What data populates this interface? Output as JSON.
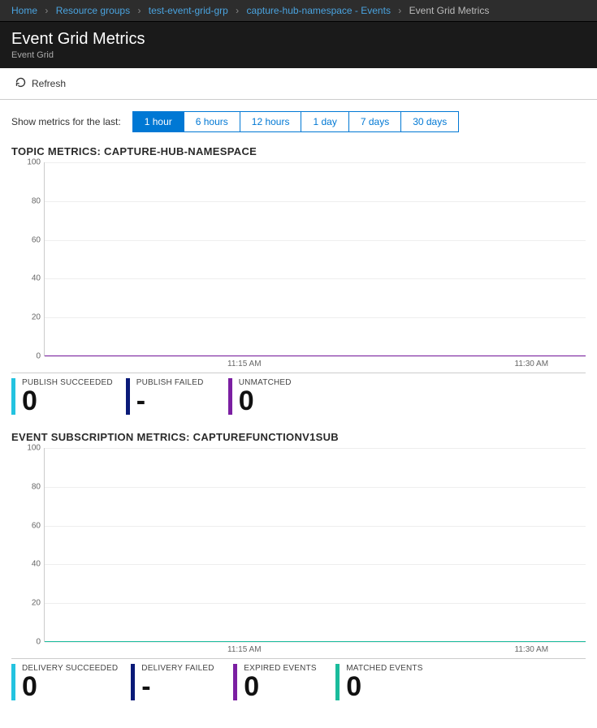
{
  "breadcrumbs": {
    "i0": "Home",
    "i1": "Resource groups",
    "i2": "test-event-grid-grp",
    "i3": "capture-hub-namespace - Events",
    "current": "Event Grid Metrics"
  },
  "header": {
    "title": "Event Grid Metrics",
    "subtitle": "Event Grid"
  },
  "toolbar": {
    "refresh_label": "Refresh"
  },
  "filter": {
    "label": "Show metrics for the last:"
  },
  "time_tabs": {
    "t0": "1 hour",
    "t1": "6 hours",
    "t2": "12 hours",
    "t3": "1 day",
    "t4": "7 days",
    "t5": "30 days",
    "selected_index": 0
  },
  "colors": {
    "cyan": "#23c3e0",
    "navy": "#0a1a78",
    "purple": "#7b1fa2",
    "teal": "#1abc9c",
    "accent": "#0078d4"
  },
  "sections": {
    "topic": {
      "title": "TOPIC METRICS: CAPTURE-HUB-NAMESPACE",
      "legend": {
        "i0": {
          "name": "PUBLISH SUCCEEDED",
          "value": "0",
          "color": "#23c3e0"
        },
        "i1": {
          "name": "PUBLISH FAILED",
          "value": "-",
          "color": "#0a1a78"
        },
        "i2": {
          "name": "UNMATCHED",
          "value": "0",
          "color": "#7b1fa2"
        }
      }
    },
    "subscription": {
      "title": "EVENT SUBSCRIPTION METRICS: CAPTUREFUNCTIONV1SUB",
      "legend": {
        "i0": {
          "name": "DELIVERY SUCCEEDED",
          "value": "0",
          "color": "#23c3e0"
        },
        "i1": {
          "name": "DELIVERY FAILED",
          "value": "-",
          "color": "#0a1a78"
        },
        "i2": {
          "name": "EXPIRED EVENTS",
          "value": "0",
          "color": "#7b1fa2"
        },
        "i3": {
          "name": "MATCHED EVENTS",
          "value": "0",
          "color": "#1abc9c"
        }
      }
    }
  },
  "chart_data": [
    {
      "type": "line",
      "title": "Topic Metrics",
      "xlabel": "",
      "ylabel": "",
      "ylim": [
        0,
        100
      ],
      "y_ticks": [
        0,
        20,
        40,
        60,
        80,
        100
      ],
      "x_ticks": [
        "11:15 AM",
        "11:30 AM"
      ],
      "x_tick_positions_pct": [
        37,
        90
      ],
      "series": [
        {
          "name": "PUBLISH SUCCEEDED",
          "color": "#23c3e0",
          "values": [
            0,
            0,
            0,
            0,
            0,
            0,
            0,
            0,
            0,
            0,
            0,
            0
          ]
        },
        {
          "name": "PUBLISH FAILED",
          "color": "#0a1a78",
          "values": [
            null,
            null,
            null,
            null,
            null,
            null,
            null,
            null,
            null,
            null,
            null,
            null
          ]
        },
        {
          "name": "UNMATCHED",
          "color": "#7b1fa2",
          "values": [
            0,
            0,
            0,
            0,
            0,
            0,
            0,
            0,
            0,
            0,
            0,
            0
          ]
        }
      ]
    },
    {
      "type": "line",
      "title": "Event Subscription Metrics",
      "xlabel": "",
      "ylabel": "",
      "ylim": [
        0,
        100
      ],
      "y_ticks": [
        0,
        20,
        40,
        60,
        80,
        100
      ],
      "x_ticks": [
        "11:15 AM",
        "11:30 AM"
      ],
      "x_tick_positions_pct": [
        37,
        90
      ],
      "series": [
        {
          "name": "DELIVERY SUCCEEDED",
          "color": "#23c3e0",
          "values": [
            0,
            0,
            0,
            0,
            0,
            0,
            0,
            0,
            0,
            0,
            0,
            0
          ]
        },
        {
          "name": "DELIVERY FAILED",
          "color": "#0a1a78",
          "values": [
            null,
            null,
            null,
            null,
            null,
            null,
            null,
            null,
            null,
            null,
            null,
            null
          ]
        },
        {
          "name": "EXPIRED EVENTS",
          "color": "#7b1fa2",
          "values": [
            0,
            0,
            0,
            0,
            0,
            0,
            0,
            0,
            0,
            0,
            0,
            0
          ]
        },
        {
          "name": "MATCHED EVENTS",
          "color": "#1abc9c",
          "values": [
            0,
            0,
            0,
            0,
            0,
            0,
            0,
            0,
            0,
            0,
            0,
            0
          ]
        }
      ]
    }
  ]
}
